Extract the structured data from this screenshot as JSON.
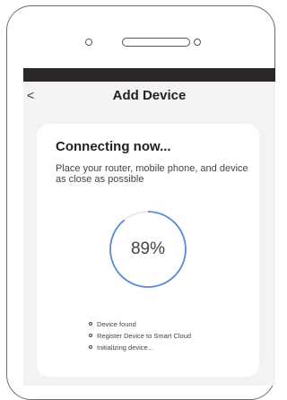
{
  "header": {
    "back_icon": "<",
    "title": "Add Device"
  },
  "connection": {
    "heading": "Connecting now...",
    "subtitle": "Place your router, mobile phone, and device as close as possible",
    "progress_label": "89%",
    "progress_percent": 89,
    "progress_color": "#5a8bd8",
    "track_color": "#e8e8e8"
  },
  "steps": [
    {
      "label": "Device found"
    },
    {
      "label": "Register Device to Smart Cloud"
    },
    {
      "label": "Initializing device..."
    }
  ],
  "icons": {
    "back": "chevron-left-icon",
    "bullet": "circle-bullet-icon"
  }
}
